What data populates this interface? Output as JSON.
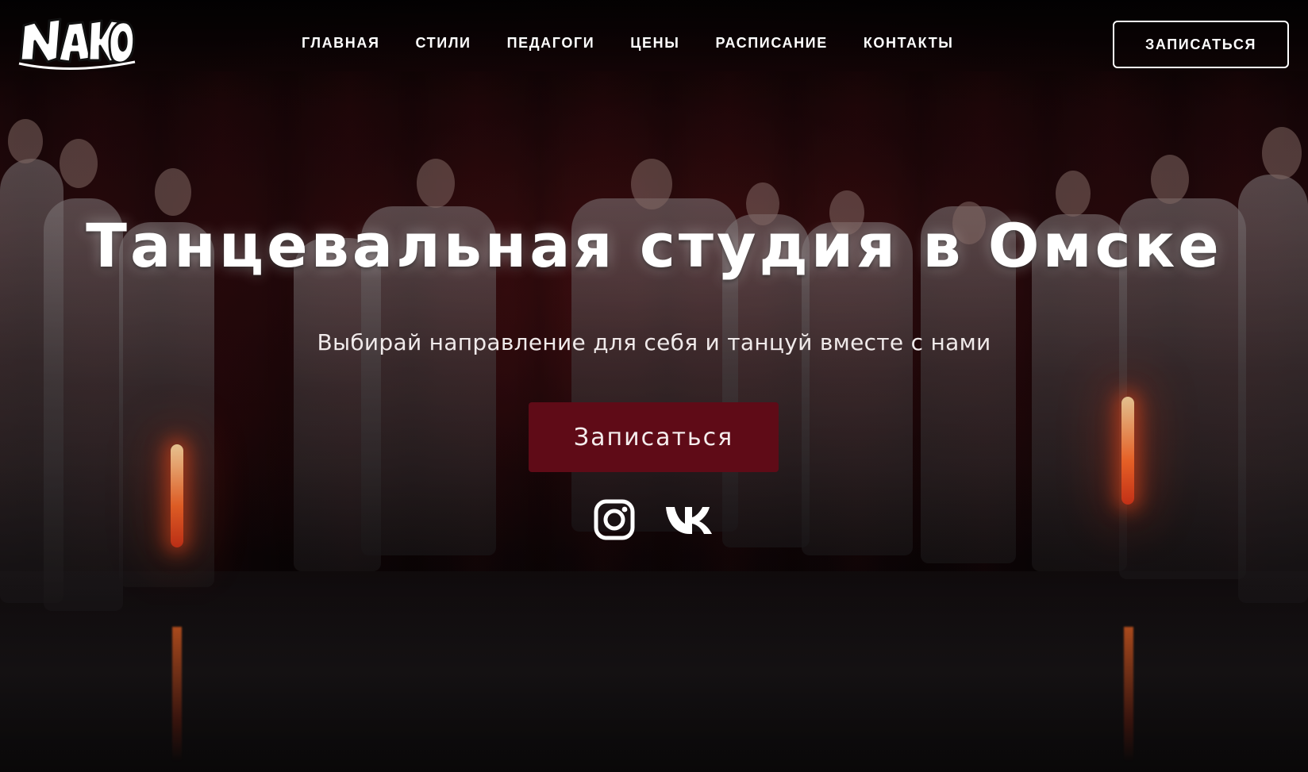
{
  "brand": {
    "logo_text": "NAKO"
  },
  "nav": {
    "items": [
      {
        "label": "ГЛАВНАЯ"
      },
      {
        "label": "СТИЛИ"
      },
      {
        "label": "ПЕДАГОГИ"
      },
      {
        "label": "ЦЕНЫ"
      },
      {
        "label": "РАСПИСАНИЕ"
      },
      {
        "label": "КОНТАКТЫ"
      }
    ],
    "signup_label": "ЗАПИСАТЬСЯ"
  },
  "hero": {
    "title": "Танцевальная студия в Омске",
    "subtitle": "Выбирай направление для себя и танцуй вместе с нами",
    "cta_label": "Записаться",
    "background_description_icon": "dance-group-photo"
  },
  "social": {
    "items": [
      {
        "icon": "instagram-icon"
      },
      {
        "icon": "vk-icon"
      }
    ]
  },
  "colors": {
    "cta_background": "#5f0b17",
    "text": "#ffffff"
  }
}
